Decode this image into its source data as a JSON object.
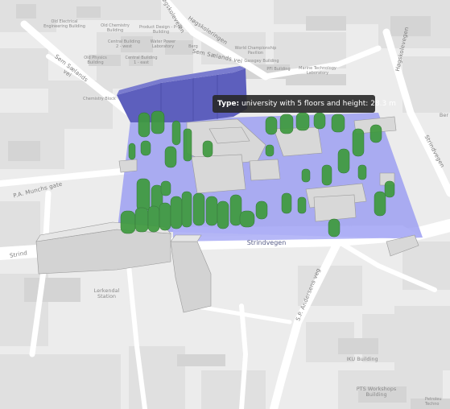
{
  "tooltip": {
    "key": "Type:",
    "value": "university with 5 floors and height: 28.3 m"
  },
  "map_labels": {
    "old_electrical_engineering_building": "Old Electrical\nEngineering Building",
    "old_chemistry_building": "Old Chemistry\nBuilding",
    "product_design_building": "Product Design - P-15\nBuilding",
    "central_building_2": "Central Building\n2 - west",
    "water_power_laboratory": "Water Power\nLaboratory",
    "berg": "Berg",
    "old_physics_building": "Old Physics\nBuilding",
    "central_building_1": "Central Building\n1 - east",
    "world_championship_pavilion": "World Championship\nPavilion",
    "gassgey_building": "Gassgey Building",
    "pfi_building": "PFI Building",
    "marine_technology_laboratory": "Marine Technology\nLaboratory",
    "chemistry_block": "Chemistry Block",
    "lerkendal_station": "Lerkendal\nStation",
    "iku_building": "IKU Building",
    "pts_workshops_building": "PTS Workshops\nBuilding",
    "ber": "Ber",
    "petroleum_technology": "Petroleu\nTechno",
    "sem_saelands_vei_1": "Sem Sælands vei",
    "sem_saelands_vei_2": "Sem Sælands vei",
    "hogskoleringen": "Høgskoleringen",
    "hogskolevegen": "Høgskolevegen",
    "strindvegen_right": "Strindvegen",
    "strindvegen_left": "Strind",
    "strindvegen_center": "Strindvegen",
    "pa_munchs_gate": "P.A. Munchs gate",
    "sp_andersens_veg": "S.P. Andersens veg",
    "hoyskoleveien_top": "Høgskoleveien"
  },
  "colors": {
    "map_background": "#ececec",
    "road": "#ffffff",
    "block": "#e1e1e1",
    "campus_area": "#9ea0f2",
    "highlight_building": "#5d5fbd",
    "tree": "#3e9a3e",
    "building_3d": "#d6d6d6"
  },
  "icons": {
    "tooltip": "info-popup"
  }
}
